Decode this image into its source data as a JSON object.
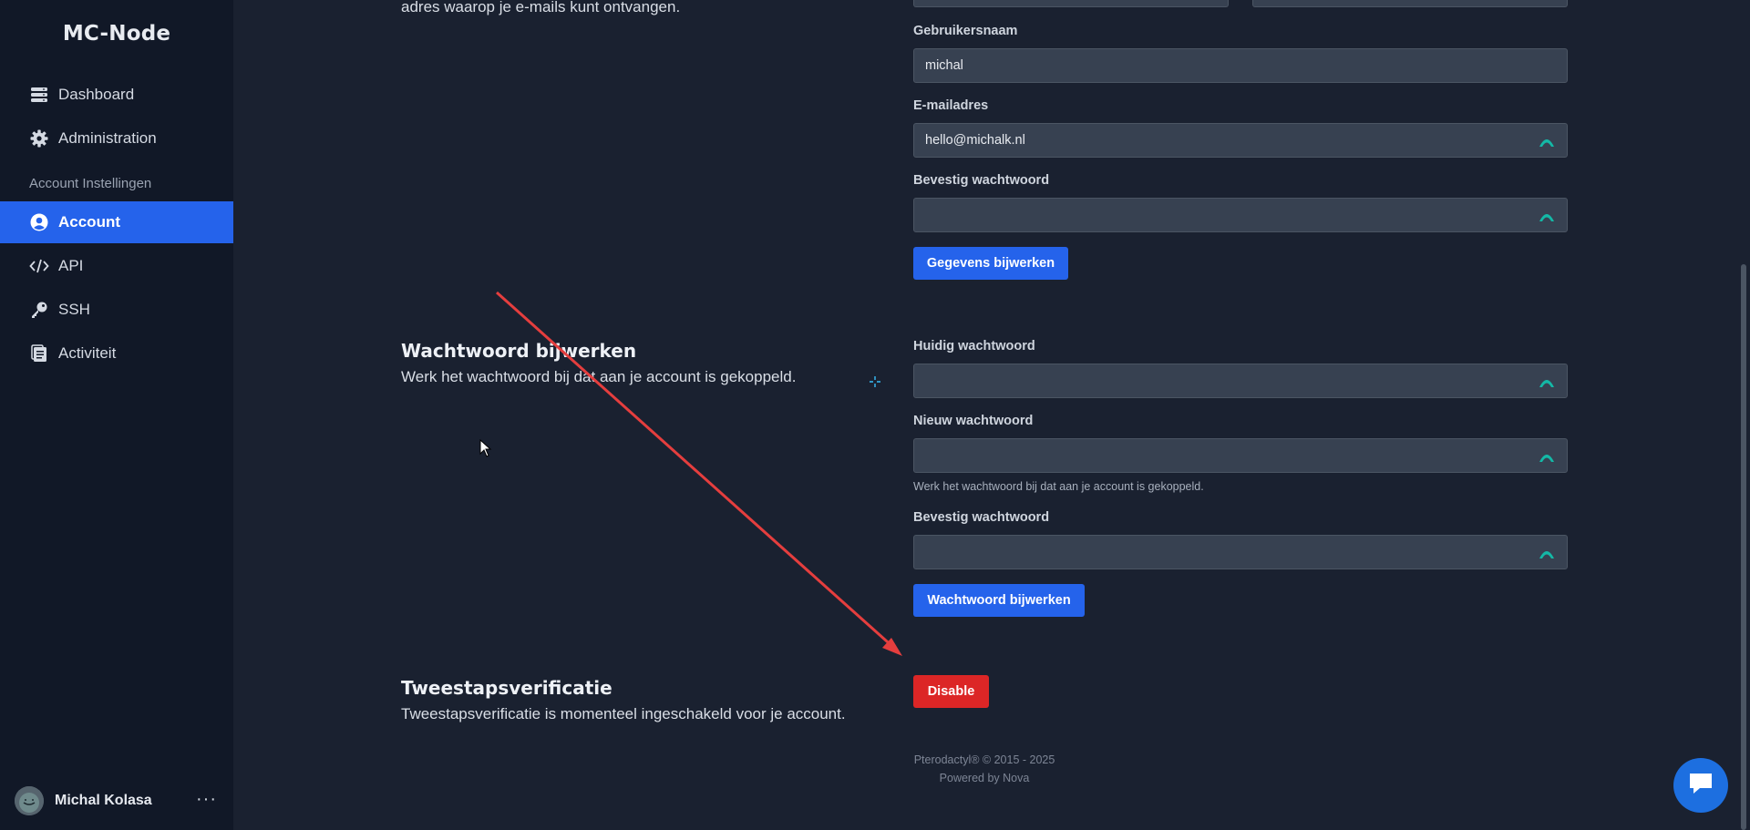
{
  "app": {
    "brand": "MC-Node"
  },
  "sidebar": {
    "items": [
      {
        "label": "Dashboard",
        "icon": "server-icon"
      },
      {
        "label": "Administration",
        "icon": "gear-icon"
      },
      {
        "label": "Account",
        "icon": "user-circle-icon",
        "active": true
      },
      {
        "label": "API",
        "icon": "code-icon"
      },
      {
        "label": "SSH",
        "icon": "key-icon"
      },
      {
        "label": "Activiteit",
        "icon": "clipboard-icon"
      }
    ],
    "section_label": "Account Instellingen",
    "user": {
      "name": "Michal Kolasa",
      "more": "···"
    }
  },
  "account": {
    "desc_tail": "adres waarop je e-mails kunt ontvangen.",
    "username_label": "Gebruikersnaam",
    "username_value": "michal",
    "email_label": "E-mailadres",
    "email_value": "hello@michalk.nl",
    "confirm_label": "Bevestig wachtwoord",
    "update_button": "Gegevens bijwerken"
  },
  "password": {
    "title": "Wachtwoord bijwerken",
    "desc": "Werk het wachtwoord bij dat aan je account is gekoppeld.",
    "current_label": "Huidig wachtwoord",
    "new_label": "Nieuw wachtwoord",
    "new_hint": "Werk het wachtwoord bij dat aan je account is gekoppeld.",
    "confirm_label": "Bevestig wachtwoord",
    "update_button": "Wachtwoord bijwerken"
  },
  "twofa": {
    "title": "Tweestapsverificatie",
    "desc": "Tweestapsverificatie is momenteel ingeschakeld voor je account.",
    "disable_button": "Disable"
  },
  "footer": {
    "copyright": "Pterodactyl® © 2015 - 2025",
    "powered": "Powered by Nova"
  },
  "colors": {
    "accent": "#2563eb",
    "danger": "#dc2626",
    "sidebar_bg": "#111827",
    "main_bg": "#1a2130",
    "input_bg": "#374151",
    "eye_icon": "#14b8a6",
    "annotation_arrow": "#e53e3e"
  }
}
